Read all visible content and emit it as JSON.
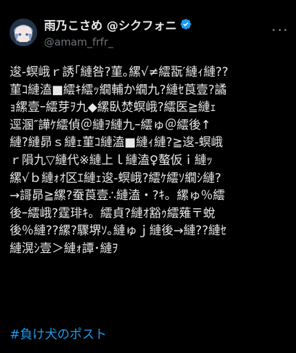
{
  "colors": {
    "background": "#000000",
    "text": "#e7e9ea",
    "secondary": "#71767b",
    "accent": "#1d9bf0"
  },
  "author": {
    "display_name": "雨乃こさめ @シクフォニ",
    "handle": "@amam_frfr_",
    "verified": true
  },
  "post": {
    "lines": [
      "逡-螟峨ｒ誘｢縺咎?菫｡縲√≠繧翫′縺ｨ縺??",
      "菫ｺ縺溘■繧ｷ繧ｯ繝輔か繝九?縺ｾ莨壹?譎",
      "ｮ縲壹ｰ繧芽ｦ九◆縲臥焚螟峨?繧医≧縺ｪ",
      "逕溷″譁ｹ繧偵＠縺ｦ縺九ｰ繧ゅ＠繧後↑",
      "縺?縺昴ｓ縺ｪ菫ｺ縺溘■縺ｨ縺?≧逡-螟峨",
      "ｒ隕九▽縺代※縺上ｌ縺溘♀螯仮ｉ縺ｯ",
      "縲√ｂ縺ｫｵ区ｴ縺ｪ逡-螟峨?繧ｹ繧ｿ繝ｼ縺?",
      "→謌昴≧縲?蚕莨壹∴縺溘・?ｷ。縲ゅ％繧",
      "後ｰ繧峨?霆琲ｷ。繧貞?縺ｵ豁ｩ繧薙〒蛻",
      "後％縺??縲?驟堺ｿ｡縺ゅｊ縺後→縺??縺ｾ",
      "縺滉ｼ壹＞縺ｫ譚･縺ｦ"
    ],
    "hashtag": "#負け犬のポスト"
  }
}
